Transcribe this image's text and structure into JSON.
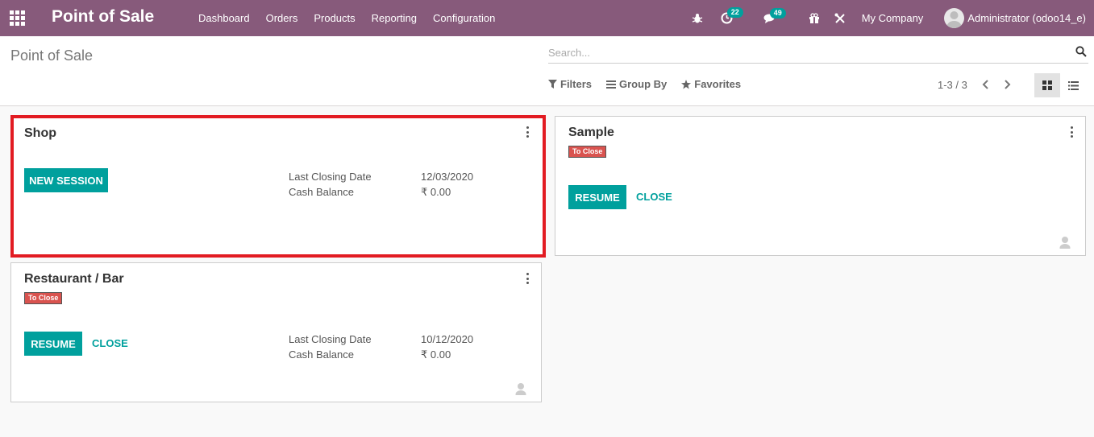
{
  "navbar": {
    "brand": "Point of Sale",
    "menu": [
      "Dashboard",
      "Orders",
      "Products",
      "Reporting",
      "Configuration"
    ],
    "activity_count": "22",
    "message_count": "49",
    "company": "My Company",
    "user": "Administrator (odoo14_e)",
    "icons": [
      "apps-grid-icon",
      "bug-icon",
      "clock-icon",
      "chat-icon",
      "gift-icon",
      "tools-icon",
      "avatar"
    ]
  },
  "control_panel": {
    "breadcrumb": "Point of Sale",
    "search_placeholder": "Search...",
    "filters_label": "Filters",
    "group_by_label": "Group By",
    "favorites_label": "Favorites",
    "pager": "1-3 / 3"
  },
  "colors": {
    "navbar": "#875a7b",
    "primary": "#00a09d",
    "tag": "#d9534f",
    "highlight": "#e21b22"
  },
  "cards": {
    "shop": {
      "title": "Shop",
      "button": "NEW SESSION",
      "closing_label": "Last Closing Date",
      "closing_value": "12/03/2020",
      "cash_label": "Cash Balance",
      "cash_value": "₹ 0.00"
    },
    "sample": {
      "title": "Sample",
      "tag": "To Close",
      "button": "RESUME",
      "link": "CLOSE"
    },
    "restaurant": {
      "title": "Restaurant / Bar",
      "tag": "To Close",
      "button": "RESUME",
      "link": "CLOSE",
      "closing_label": "Last Closing Date",
      "closing_value": "10/12/2020",
      "cash_label": "Cash Balance",
      "cash_value": "₹ 0.00"
    }
  }
}
